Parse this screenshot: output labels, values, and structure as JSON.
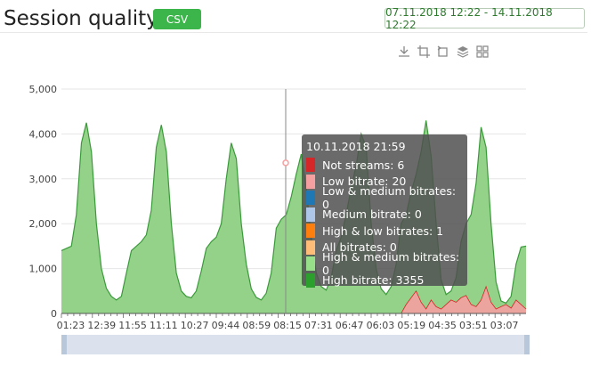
{
  "header": {
    "title": "Session quality",
    "csv_label": "CSV",
    "date_range": "07.11.2018 12:22 - 14.11.2018 12:22"
  },
  "toolbar": {
    "icons": [
      "download-icon",
      "crop-icon",
      "rotate-icon",
      "layers-icon",
      "grid-icon"
    ]
  },
  "colors": {
    "not_streams": "#d62728",
    "low_bitrate": "#f4a0a0",
    "low_medium": "#1f77b4",
    "medium": "#aec7e8",
    "high_low": "#ff7f0e",
    "all": "#ffbb78",
    "high_medium": "#98df8a",
    "high": "#2ca02c",
    "area_fill": "#94d28a",
    "area_stroke": "#3a9a3a"
  },
  "tooltip": {
    "date": "10.11.2018 21:59",
    "items": [
      {
        "label": "Not streams: 6",
        "color": "#d62728"
      },
      {
        "label": "Low bitrate: 20",
        "color": "#f4a0a0"
      },
      {
        "label": "Low & medium bitrates: 0",
        "color": "#1f77b4"
      },
      {
        "label": "Medium bitrate: 0",
        "color": "#aec7e8"
      },
      {
        "label": "High & low bitrates: 1",
        "color": "#ff7f0e"
      },
      {
        "label": "All bitrates: 0",
        "color": "#ffbb78"
      },
      {
        "label": "High & medium bitrates: 0",
        "color": "#98df8a"
      },
      {
        "label": "High bitrate: 3355",
        "color": "#2ca02c"
      }
    ]
  },
  "chart_data": {
    "type": "area",
    "ylim": [
      0,
      5000
    ],
    "y_ticks": [
      0,
      1000,
      2000,
      3000,
      4000,
      5000
    ],
    "y_tick_labels": [
      "0",
      "1,000",
      "2,000",
      "3,000",
      "4,000",
      "5,000"
    ],
    "x_tick_labels": [
      "01:23",
      "12:39",
      "11:55",
      "11:11",
      "10:27",
      "09:44",
      "08:59",
      "08:15",
      "07:31",
      "06:47",
      "06:03",
      "05:19",
      "04:35",
      "03:51",
      "03:07"
    ],
    "grid": true,
    "series": [
      {
        "name": "High bitrate",
        "values": [
          1400,
          1450,
          1500,
          2200,
          3800,
          4250,
          3600,
          2000,
          1000,
          560,
          380,
          300,
          380,
          900,
          1400,
          1500,
          1600,
          1750,
          2300,
          3700,
          4200,
          3600,
          2000,
          900,
          500,
          380,
          350,
          500,
          950,
          1450,
          1600,
          1700,
          2000,
          3000,
          3800,
          3450,
          2000,
          1100,
          550,
          360,
          300,
          450,
          900,
          1900,
          2100,
          2200,
          2600,
          3100,
          3550,
          2800,
          1700,
          900,
          600,
          520,
          800,
          1400,
          1700,
          2200,
          2800,
          3300,
          4000,
          3700,
          2000,
          1000,
          550,
          420,
          600,
          1100,
          2000,
          2200,
          2700,
          3100,
          3600,
          4300,
          3500,
          2000,
          750,
          420,
          500,
          800,
          1600,
          2000,
          2200,
          2900,
          4150,
          3700,
          2000,
          700,
          280,
          230,
          380,
          1100,
          1480,
          1500
        ]
      },
      {
        "name": "Low bitrate",
        "values": [
          0,
          0,
          0,
          0,
          0,
          0,
          0,
          0,
          0,
          0,
          0,
          0,
          0,
          0,
          0,
          0,
          0,
          0,
          0,
          0,
          0,
          0,
          0,
          0,
          0,
          0,
          0,
          0,
          0,
          0,
          0,
          0,
          0,
          0,
          0,
          0,
          0,
          0,
          0,
          0,
          0,
          0,
          0,
          0,
          0,
          0,
          0,
          0,
          0,
          0,
          0,
          0,
          0,
          0,
          0,
          0,
          0,
          0,
          0,
          0,
          0,
          0,
          0,
          0,
          0,
          0,
          0,
          0,
          0,
          200,
          350,
          500,
          250,
          100,
          300,
          150,
          100,
          200,
          300,
          250,
          350,
          400,
          200,
          150,
          300,
          600,
          250,
          100,
          150,
          200,
          120,
          300,
          200,
          100
        ]
      }
    ],
    "cursor_label": "10.11.2018 21:59"
  }
}
